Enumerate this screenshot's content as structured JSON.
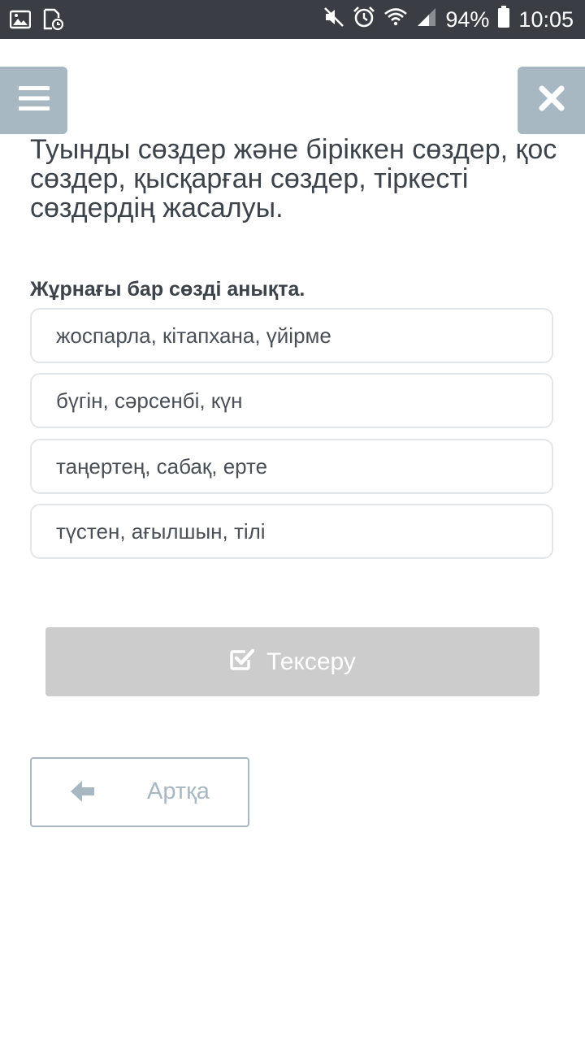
{
  "status_bar": {
    "battery": "94%",
    "time": "10:05"
  },
  "header": {
    "menu_icon": "hamburger-icon",
    "close_icon": "close-icon"
  },
  "lesson": {
    "title": "Туынды сөздер және біріккен сөздер, қос сөздер, қысқарған сөздер, тіркесті сөздердің жасалуы."
  },
  "quiz": {
    "question": "Жұрнағы бар сөзді анықта.",
    "answers": [
      "жоспарла, кітапхана, үйірме",
      "бүгін, сәрсенбі, күн",
      "таңертең, сабақ, ерте",
      "түстен, ағылшын, тілі"
    ]
  },
  "actions": {
    "check_label": "Тексеру",
    "back_label": "Артқа"
  },
  "colors": {
    "status_bar": "#3a3e44",
    "side_buttons": "#a7b8c3",
    "check_button": "#cccccc",
    "text": "#3d434b"
  }
}
